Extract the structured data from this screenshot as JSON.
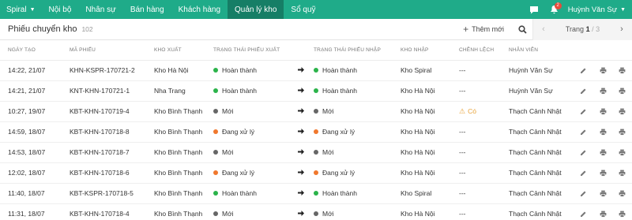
{
  "nav": {
    "brand": "Spiral",
    "items": [
      {
        "label": "Nội bộ",
        "active": false
      },
      {
        "label": "Nhân sự",
        "active": false
      },
      {
        "label": "Bán hàng",
        "active": false
      },
      {
        "label": "Khách hàng",
        "active": false
      },
      {
        "label": "Quản lý kho",
        "active": true
      },
      {
        "label": "Sổ quỹ",
        "active": false
      }
    ],
    "notification_count": "2",
    "user_name": "Huỳnh Văn Sự"
  },
  "toolbar": {
    "title": "Phiếu chuyển kho",
    "count": "102",
    "add_label": "Thêm mới",
    "page_label": "Trang",
    "page_current": "1",
    "page_total": "/ 3"
  },
  "table": {
    "headers": [
      "NGÀY TẠO",
      "MÃ PHIẾU",
      "KHO XUẤT",
      "TRẠNG THÁI PHIẾU XUẤT",
      "",
      "TRẠNG THÁI PHIẾU NHẬP",
      "KHO NHẬP",
      "CHÊNH LỆCH",
      "NHÂN VIÊN"
    ],
    "rows": [
      {
        "date": "14:22, 21/07",
        "code": "KHN-KSPR-170721-2",
        "from": "Kho Hà Nội",
        "out_status": "Hoàn thành",
        "out_color": "#2bb34a",
        "in_status": "Hoàn thành",
        "in_color": "#2bb34a",
        "to": "Kho Spiral",
        "diff": "---",
        "diff_warn": false,
        "staff": "Huỳnh Văn Sự"
      },
      {
        "date": "14:21, 21/07",
        "code": "KNT-KHN-170721-1",
        "from": "Nha Trang",
        "out_status": "Hoàn thành",
        "out_color": "#2bb34a",
        "in_status": "Hoàn thành",
        "in_color": "#2bb34a",
        "to": "Kho Hà Nội",
        "diff": "---",
        "diff_warn": false,
        "staff": "Huỳnh Văn Sự"
      },
      {
        "date": "10:27, 19/07",
        "code": "KBT-KHN-170719-4",
        "from": "Kho Bình Thạnh",
        "out_status": "Mới",
        "out_color": "#666666",
        "in_status": "Mới",
        "in_color": "#666666",
        "to": "Kho Hà Nội",
        "diff": "Có",
        "diff_warn": true,
        "staff": "Thạch Cảnh Nhật"
      },
      {
        "date": "14:59, 18/07",
        "code": "KBT-KHN-170718-8",
        "from": "Kho Bình Thạnh",
        "out_status": "Đang xử lý",
        "out_color": "#f0782d",
        "in_status": "Đang xử lý",
        "in_color": "#f0782d",
        "to": "Kho Hà Nội",
        "diff": "---",
        "diff_warn": false,
        "staff": "Thạch Cảnh Nhật"
      },
      {
        "date": "14:53, 18/07",
        "code": "KBT-KHN-170718-7",
        "from": "Kho Bình Thạnh",
        "out_status": "Mới",
        "out_color": "#666666",
        "in_status": "Mới",
        "in_color": "#666666",
        "to": "Kho Hà Nội",
        "diff": "---",
        "diff_warn": false,
        "staff": "Thạch Cảnh Nhật"
      },
      {
        "date": "12:02, 18/07",
        "code": "KBT-KHN-170718-6",
        "from": "Kho Bình Thạnh",
        "out_status": "Đang xử lý",
        "out_color": "#f0782d",
        "in_status": "Đang xử lý",
        "in_color": "#f0782d",
        "to": "Kho Hà Nội",
        "diff": "---",
        "diff_warn": false,
        "staff": "Thạch Cảnh Nhật"
      },
      {
        "date": "11:40, 18/07",
        "code": "KBT-KSPR-170718-5",
        "from": "Kho Bình Thạnh",
        "out_status": "Hoàn thành",
        "out_color": "#2bb34a",
        "in_status": "Hoàn thành",
        "in_color": "#2bb34a",
        "to": "Kho Spiral",
        "diff": "---",
        "diff_warn": false,
        "staff": "Thạch Cảnh Nhật"
      },
      {
        "date": "11:31, 18/07",
        "code": "KBT-KHN-170718-4",
        "from": "Kho Bình Thạnh",
        "out_status": "Mới",
        "out_color": "#666666",
        "in_status": "Mới",
        "in_color": "#666666",
        "to": "Kho Hà Nội",
        "diff": "---",
        "diff_warn": false,
        "staff": "Thạch Cảnh Nhật"
      }
    ]
  },
  "colors": {
    "nav_bg": "#1fab89",
    "nav_active": "#167e66",
    "warning": "#e8a33a"
  },
  "icons": [
    "chat-icon",
    "bell-icon",
    "plus-icon",
    "search-icon",
    "chevron-left-icon",
    "chevron-right-icon",
    "arrow-right-icon",
    "warning-icon",
    "edit-icon",
    "print-icon"
  ]
}
